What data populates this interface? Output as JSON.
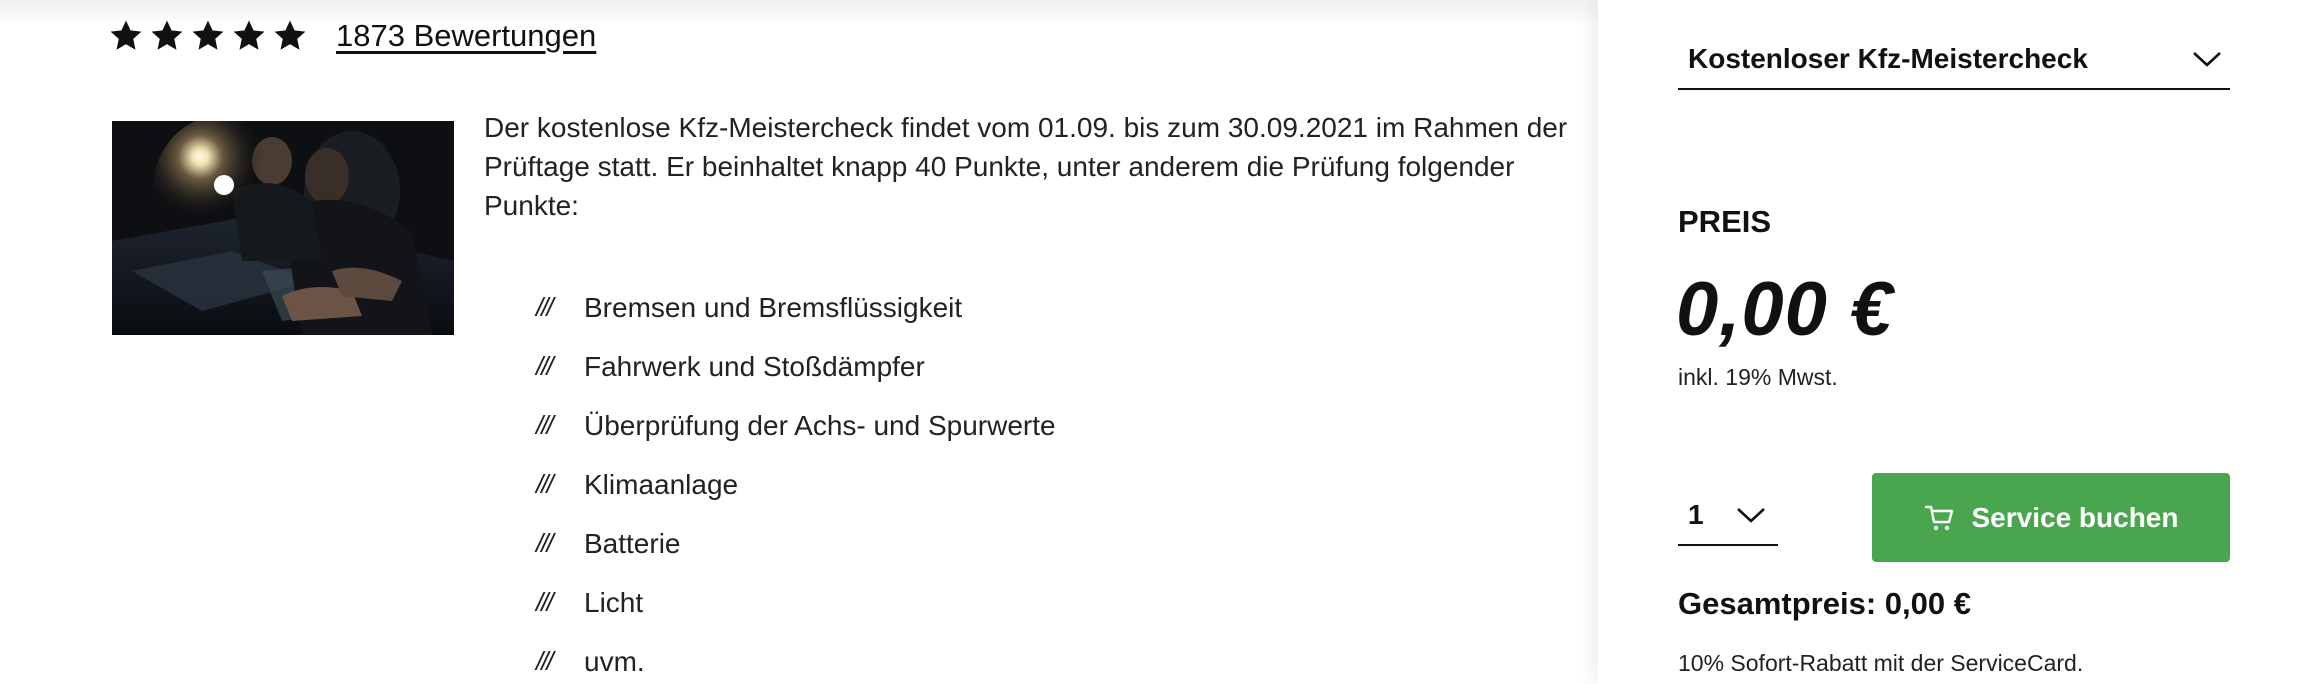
{
  "rating": {
    "stars": 5,
    "max_stars": 5,
    "reviews_text": "1873 Bewertungen"
  },
  "product": {
    "image_alt": "Mechaniker prüft Motorraum",
    "description": "Der kostenlose Kfz-Meistercheck findet vom 01.09. bis zum 30.09.2021 im  Rahmen der Prüftage statt. Er beinhaltet knapp 40 Punkte, unter anderem die Prüfung folgender Punkte:",
    "list_marker": "///",
    "checklist": [
      "Bremsen und Bremsflüssigkeit",
      "Fahrwerk und Stoßdämpfer",
      "Überprüfung der Achs- und Spurwerte",
      "Klimaanlage",
      "Batterie",
      "Licht",
      "uvm."
    ]
  },
  "panel": {
    "service_select_value": "Kostenloser Kfz-Meistercheck",
    "price_label": "PREIS",
    "price": "0,00 €",
    "tax_note": "inkl. 19% Mwst.",
    "quantity": "1",
    "book_button_label": "Service buchen",
    "total": "Gesamtpreis: 0,00 €",
    "discount_note": "10% Sofort-Rabatt mit der ServiceCard."
  },
  "icons": {
    "star": "star-icon",
    "chevron": "chevron-down-icon",
    "cart": "cart-icon"
  },
  "colors": {
    "accent_green": "#4aa54f",
    "text": "#111111"
  }
}
